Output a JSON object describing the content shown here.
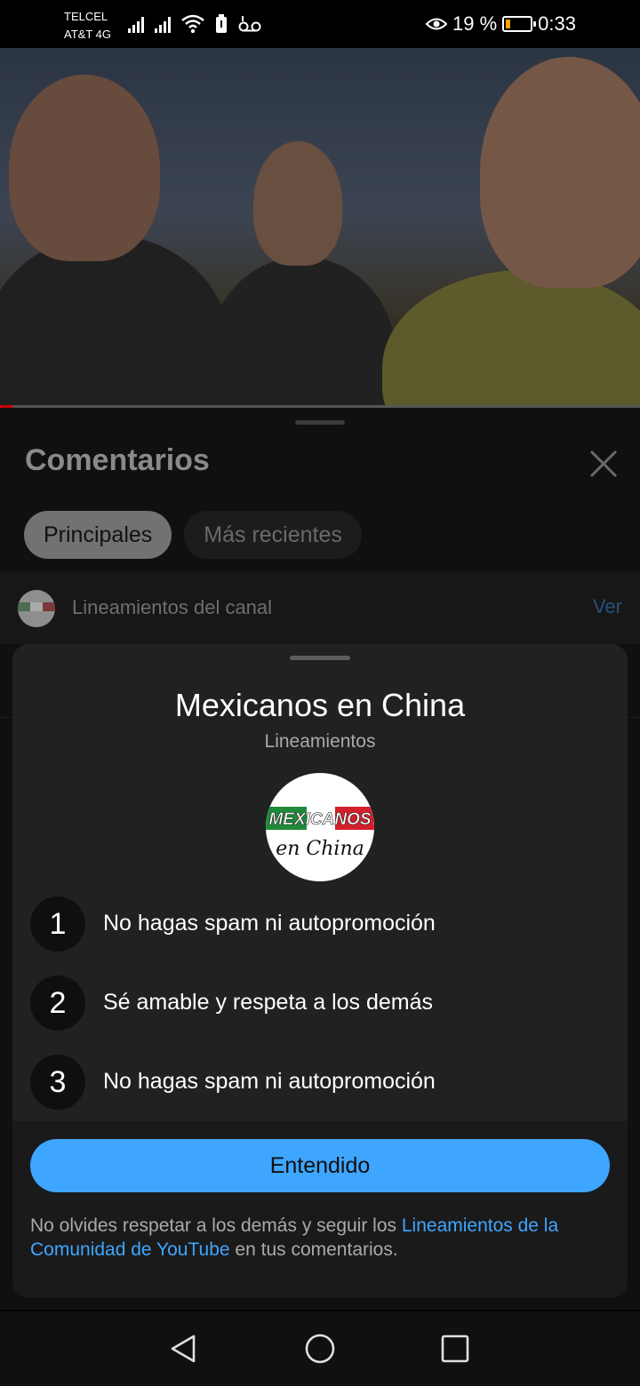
{
  "status_bar": {
    "carrier_1": "TELCEL",
    "carrier_2": "AT&T 4G",
    "battery_text": "19 %",
    "battery_level": 0.19,
    "time": "0:33"
  },
  "video": {
    "progress_fraction": 0.02
  },
  "comments": {
    "title": "Comentarios",
    "tabs": [
      {
        "label": "Principales",
        "active": true
      },
      {
        "label": "Más recientes",
        "active": false
      }
    ],
    "guidelines_row": {
      "label": "Lineamientos del canal",
      "action": "Ver"
    }
  },
  "dialog": {
    "channel_name": "Mexicanos en China",
    "subtitle": "Lineamientos",
    "logo_text": "MEXICANOS en China",
    "rules": [
      {
        "number": "1",
        "text": "No hagas spam ni autopromoción"
      },
      {
        "number": "2",
        "text": "Sé amable y respeta a los demás"
      },
      {
        "number": "3",
        "text": "No hagas spam ni autopromoción"
      }
    ],
    "button_label": "Entendido",
    "footer": {
      "text_before": "No olvides respetar a los demás y seguir los ",
      "link": "Lineamientos de la Comunidad de YouTube",
      "text_after": " en tus comentarios."
    }
  },
  "colors": {
    "accent": "#3ea6ff",
    "dialog_bg": "#212121",
    "flag_green": "#1e8a3a",
    "flag_red": "#d4202c"
  },
  "icons": {
    "close": "close-icon",
    "back": "back-triangle-icon",
    "home": "home-circle-icon",
    "recents": "recents-square-icon"
  }
}
